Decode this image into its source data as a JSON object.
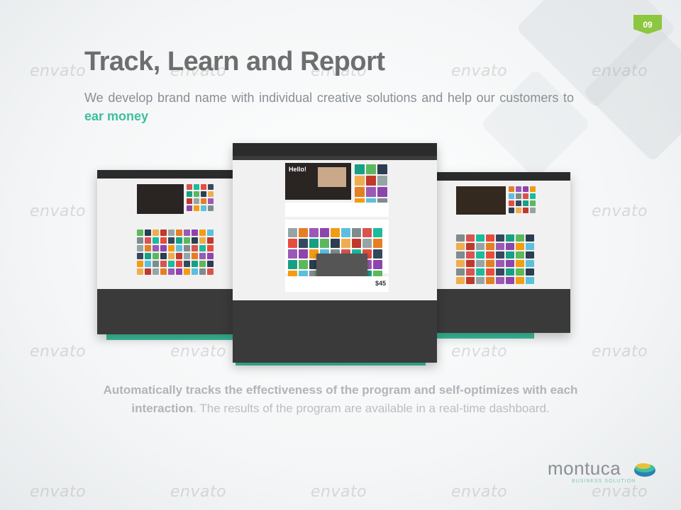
{
  "page_number": "09",
  "title": "Track, Learn and Report",
  "subtitle": {
    "text": "We develop brand name with individual creative solutions and help our customers to",
    "highlight": "ear money"
  },
  "bottom_text": {
    "strong": "Automatically tracks the effectiveness of the program and self-optimizes with each interaction",
    "regular": ". The results of the program are available in a real-time dashboard."
  },
  "mockup_screens": {
    "hero_label": "Hello!",
    "price_label": "$45"
  },
  "logo": {
    "name": "montuca",
    "tagline": "BUSINESS SOLUTION"
  },
  "watermark_text": "envato",
  "colors": {
    "accent": "#3dbf9e",
    "badge": "#8dc63f",
    "title": "#6e6e6e"
  }
}
